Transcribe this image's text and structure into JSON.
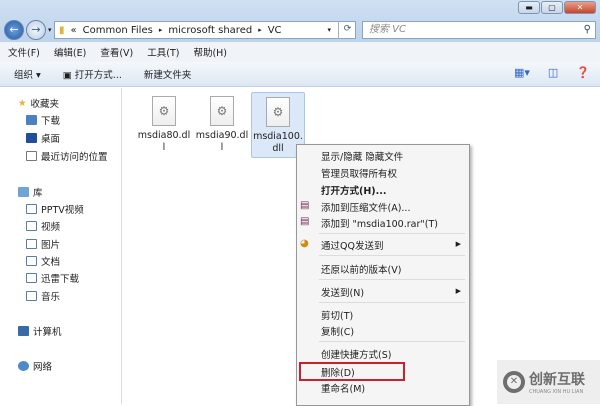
{
  "window": {
    "controls": [
      "minimize",
      "maximize",
      "close"
    ]
  },
  "address": {
    "prefix": "«",
    "crumbs": [
      "Common Files",
      "microsoft shared",
      "VC"
    ],
    "separator": "▸"
  },
  "search": {
    "placeholder": "搜索 VC"
  },
  "menubar": [
    "文件(F)",
    "编辑(E)",
    "查看(V)",
    "工具(T)",
    "帮助(H)"
  ],
  "toolbar": {
    "organize": "组织 ▾",
    "open_with": "打开方式...",
    "new_folder": "新建文件夹"
  },
  "sidebar": {
    "favorites": "收藏夹",
    "downloads": "下载",
    "desktop": "桌面",
    "recent": "最近访问的位置",
    "libraries": "库",
    "pptv": "PPTV视频",
    "videos": "视频",
    "pictures": "图片",
    "documents": "文档",
    "thunder": "迅雷下载",
    "music": "音乐",
    "computer": "计算机",
    "network": "网络"
  },
  "files": [
    {
      "name": "msdia80.dll"
    },
    {
      "name": "msdia90.dll"
    },
    {
      "name": "msdia100.dll",
      "selected": true
    }
  ],
  "context_menu": [
    "显示/隐藏 隐藏文件",
    "管理员取得所有权",
    "打开方式(H)...",
    "添加到压缩文件(A)...",
    "添加到 \"msdia100.rar\"(T)",
    "通过QQ发送到",
    "还原以前的版本(V)",
    "发送到(N)",
    "剪切(T)",
    "复制(C)",
    "创建快捷方式(S)",
    "删除(D)",
    "重命名(M)"
  ],
  "watermark": {
    "name": "创新互联",
    "sub": "CHUANG XIN HU LIAN"
  }
}
